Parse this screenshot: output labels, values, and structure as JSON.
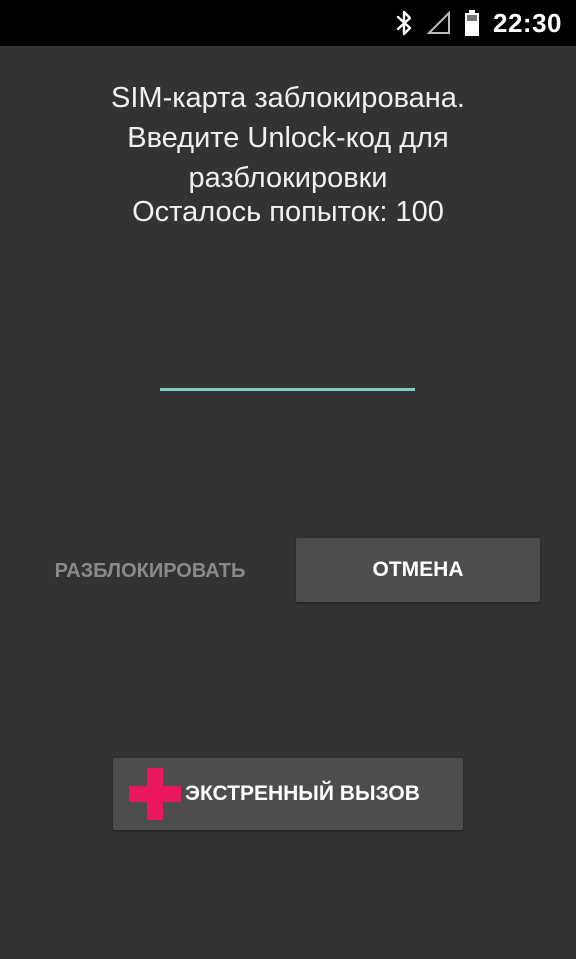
{
  "status_bar": {
    "time": "22:30",
    "icons": [
      "bluetooth-icon",
      "signal-icon",
      "battery-icon"
    ]
  },
  "lock_screen": {
    "message_lines": [
      "SIM-карта заблокирована.",
      "Введите Unlock-код для",
      "разблокировки"
    ],
    "attempts_text": "Осталось попыток: 100",
    "code_input": {
      "value": "",
      "placeholder": ""
    },
    "unlock_label": "РАЗБЛОКИРОВАТЬ",
    "cancel_label": "ОТМЕНА",
    "emergency_label": "ЭКСТРЕННЫЙ ВЫЗОВ"
  },
  "colors": {
    "background": "#333333",
    "status_bar": "#000000",
    "input_underline": "#7fcfc3",
    "button_bg": "#4d4d4d",
    "emergency_cross": "#e8185a",
    "disabled_text": "#8a8a8a"
  }
}
